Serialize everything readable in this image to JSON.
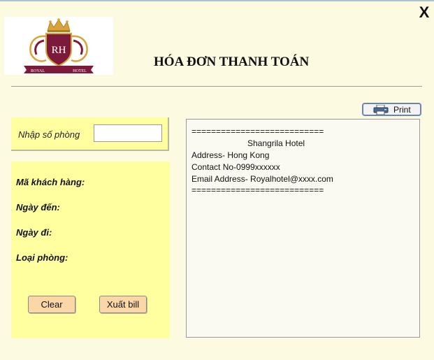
{
  "window": {
    "close_label": "X"
  },
  "logo": {
    "monogram": "RH",
    "left_word": "ROYAL",
    "right_word": "HOTEL"
  },
  "header": {
    "title": "HÓA ĐƠN THANH TOÁN"
  },
  "room_panel": {
    "label": "Nhập số phòng",
    "input_value": "",
    "input_placeholder": ""
  },
  "info_panel": {
    "customer_id_label": "Mã khách hàng:",
    "arrival_label": "Ngày đến:",
    "departure_label": "Ngày đi:",
    "room_type_label": "Loại phòng:"
  },
  "buttons": {
    "clear": "Clear",
    "export_bill": "Xuất bill",
    "print": "Print"
  },
  "receipt": {
    "lines": [
      "===========================",
      "Shangrila Hotel",
      "Address- Hong Kong",
      "Contact No-0999xxxxxx",
      "Email Address- Royalhotel@xxxx.com",
      "==========================="
    ]
  },
  "colors": {
    "background": "#fcfae0",
    "panel_yellow": "#ffffa0",
    "button_peach": "#fbd7a8",
    "logo_maroon": "#7d1a3c",
    "logo_gold": "#d9a33c"
  }
}
